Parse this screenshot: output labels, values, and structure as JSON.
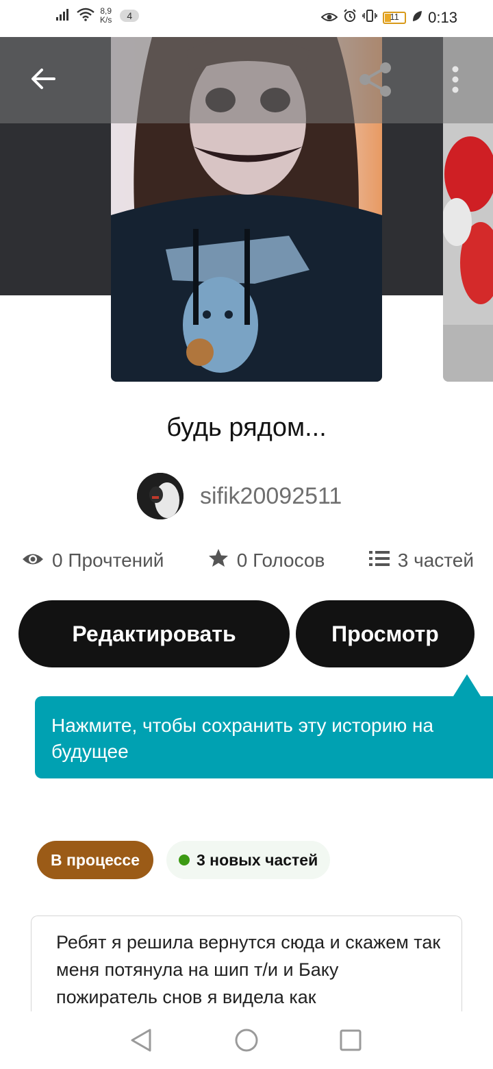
{
  "status_bar": {
    "net_speed_value": "8,9",
    "net_speed_unit": "K/s",
    "notification_count": "4",
    "battery_level": "11",
    "time": "0:13"
  },
  "toolbar": {
    "back_icon": "arrow-left-icon",
    "share_icon": "share-icon",
    "more_icon": "more-vertical-icon"
  },
  "story": {
    "title": "будь рядом...",
    "author": "sifik20092511",
    "stats": {
      "reads": "0 Прочтений",
      "votes": "0 Голосов",
      "parts": "3 частей"
    }
  },
  "actions": {
    "edit_label": "Редактировать",
    "preview_label": "Просмотр"
  },
  "tooltip": {
    "text": "Нажмите, чтобы сохранить эту историю на будущее"
  },
  "badges": {
    "status": "В процессе",
    "new_parts": "3 новых частей"
  },
  "description": {
    "text": "Ребят я решила вернутся сюда и скажем так меня потянула на шип т/и и Баку пожиратель снов я видела как"
  },
  "colors": {
    "primary_button": "#121212",
    "tooltip": "#00a1b2",
    "status_badge": "#9b5b17",
    "new_dot": "#3c9a13"
  }
}
